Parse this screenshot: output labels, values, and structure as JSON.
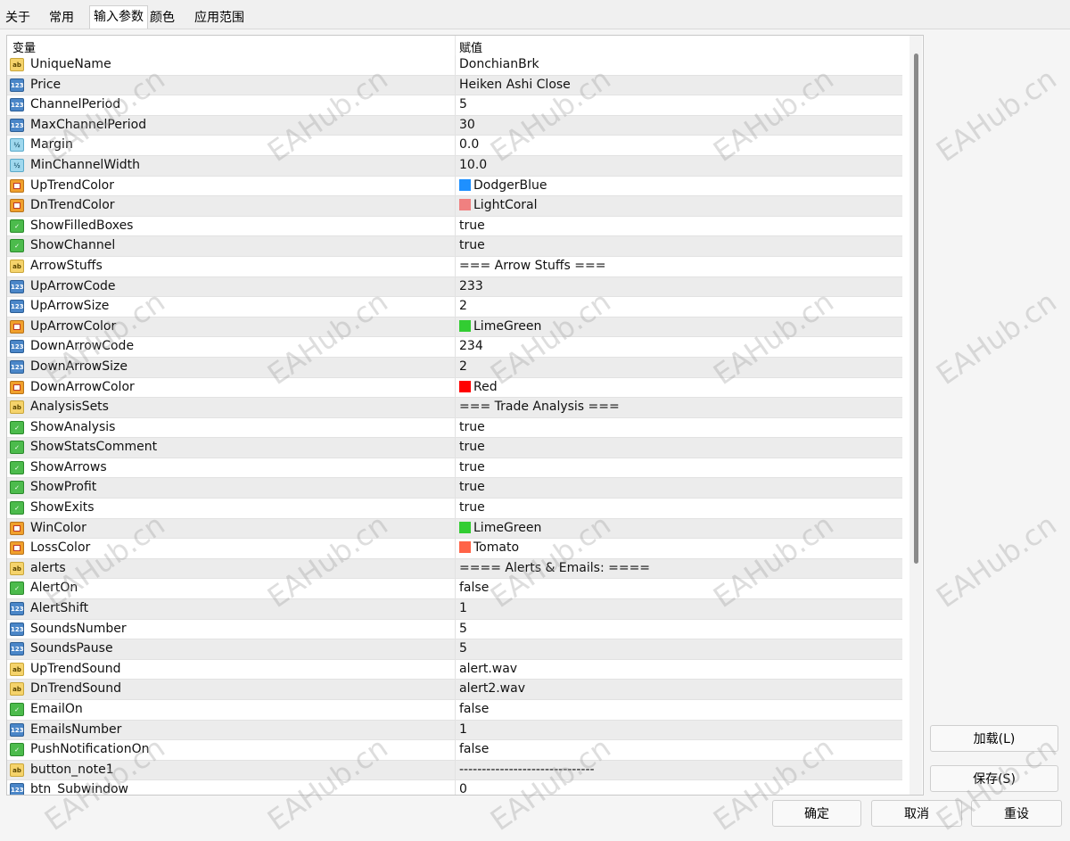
{
  "tabs": [
    {
      "label": "关于"
    },
    {
      "label": "常用"
    },
    {
      "label": "输入参数"
    },
    {
      "label": "颜色"
    },
    {
      "label": "应用范围"
    }
  ],
  "grid": {
    "col_variable": "变量",
    "col_value": "赋值",
    "rows": [
      {
        "type": "ab",
        "name": "UniqueName",
        "value": "DonchianBrk"
      },
      {
        "type": "num",
        "name": "Price",
        "value": "Heiken Ashi Close"
      },
      {
        "type": "num",
        "name": "ChannelPeriod",
        "value": "5"
      },
      {
        "type": "num",
        "name": "MaxChannelPeriod",
        "value": "30"
      },
      {
        "type": "dbl",
        "name": "Margin",
        "value": "0.0"
      },
      {
        "type": "dbl",
        "name": "MinChannelWidth",
        "value": "10.0"
      },
      {
        "type": "color",
        "name": "UpTrendColor",
        "value": "DodgerBlue",
        "swatch": "#1e90ff"
      },
      {
        "type": "color",
        "name": "DnTrendColor",
        "value": "LightCoral",
        "swatch": "#f08080"
      },
      {
        "type": "bool",
        "name": "ShowFilledBoxes",
        "value": "true"
      },
      {
        "type": "bool",
        "name": "ShowChannel",
        "value": "true"
      },
      {
        "type": "ab",
        "name": "ArrowStuffs",
        "value": "=== Arrow Stuffs ==="
      },
      {
        "type": "num",
        "name": "UpArrowCode",
        "value": "233"
      },
      {
        "type": "num",
        "name": "UpArrowSize",
        "value": "2"
      },
      {
        "type": "color",
        "name": "UpArrowColor",
        "value": "LimeGreen",
        "swatch": "#32cd32"
      },
      {
        "type": "num",
        "name": "DownArrowCode",
        "value": "234"
      },
      {
        "type": "num",
        "name": "DownArrowSize",
        "value": "2"
      },
      {
        "type": "color",
        "name": "DownArrowColor",
        "value": "Red",
        "swatch": "#ff0000"
      },
      {
        "type": "ab",
        "name": "AnalysisSets",
        "value": "=== Trade Analysis ==="
      },
      {
        "type": "bool",
        "name": "ShowAnalysis",
        "value": "true"
      },
      {
        "type": "bool",
        "name": "ShowStatsComment",
        "value": "true"
      },
      {
        "type": "bool",
        "name": "ShowArrows",
        "value": "true"
      },
      {
        "type": "bool",
        "name": "ShowProfit",
        "value": "true"
      },
      {
        "type": "bool",
        "name": "ShowExits",
        "value": "true"
      },
      {
        "type": "color",
        "name": "WinColor",
        "value": "LimeGreen",
        "swatch": "#32cd32"
      },
      {
        "type": "color",
        "name": "LossColor",
        "value": "Tomato",
        "swatch": "#ff6347"
      },
      {
        "type": "ab",
        "name": "alerts",
        "value": "==== Alerts & Emails: ===="
      },
      {
        "type": "bool",
        "name": "AlertOn",
        "value": "false"
      },
      {
        "type": "num",
        "name": "AlertShift",
        "value": "1"
      },
      {
        "type": "num",
        "name": "SoundsNumber",
        "value": "5"
      },
      {
        "type": "num",
        "name": "SoundsPause",
        "value": "5"
      },
      {
        "type": "ab",
        "name": "UpTrendSound",
        "value": "alert.wav"
      },
      {
        "type": "ab",
        "name": "DnTrendSound",
        "value": "alert2.wav"
      },
      {
        "type": "bool",
        "name": "EmailOn",
        "value": "false"
      },
      {
        "type": "num",
        "name": "EmailsNumber",
        "value": "1"
      },
      {
        "type": "bool",
        "name": "PushNotificationOn",
        "value": "false"
      },
      {
        "type": "ab",
        "name": "button_note1",
        "value": "------------------------------"
      },
      {
        "type": "num",
        "name": "btn_Subwindow",
        "value": "0"
      }
    ]
  },
  "buttons": {
    "load": "加载(L)",
    "save": "保存(S)",
    "ok": "确定",
    "cancel": "取消",
    "reset": "重设"
  },
  "watermark": "EAHub.cn",
  "icon_labels": {
    "ab": "ab",
    "num": "123",
    "dbl": "½",
    "bool": "✓",
    "color": ""
  }
}
